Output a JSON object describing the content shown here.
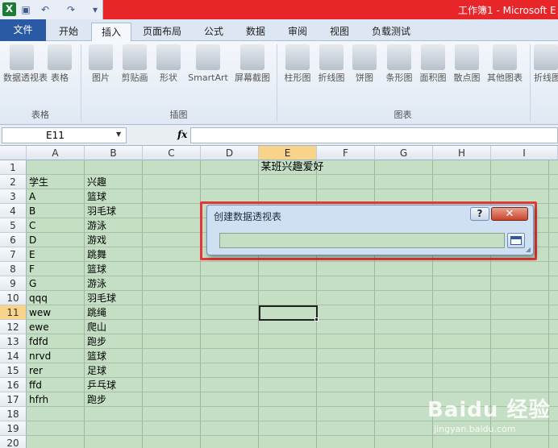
{
  "app": {
    "title": "工作簿1 - Microsoft E"
  },
  "tabs": [
    "文件",
    "开始",
    "插入",
    "页面布局",
    "公式",
    "数据",
    "审阅",
    "视图",
    "负载测试"
  ],
  "ribbon": {
    "tables_group": {
      "label": "表格",
      "buttons": [
        "数据透视表",
        "表格"
      ]
    },
    "illustrations_group": {
      "label": "插图",
      "buttons": [
        "图片",
        "剪贴画",
        "形状",
        "SmartArt",
        "屏幕截图"
      ]
    },
    "charts_group": {
      "label": "图表",
      "buttons": [
        "柱形图",
        "折线图",
        "饼图",
        "条形图",
        "面积图",
        "散点图",
        "其他图表"
      ]
    },
    "extra_button": "折线图"
  },
  "formula_bar": {
    "name_box": "E11",
    "fx": "fx",
    "value": ""
  },
  "columns": [
    "A",
    "B",
    "C",
    "D",
    "E",
    "F",
    "G",
    "H",
    "I"
  ],
  "selected_column": "E",
  "rows": [
    "1",
    "2",
    "3",
    "4",
    "5",
    "6",
    "7",
    "8",
    "9",
    "10",
    "11",
    "12",
    "13",
    "14",
    "15",
    "16",
    "17",
    "18",
    "19",
    "20"
  ],
  "selected_row": "11",
  "sheet": {
    "title": "某班兴趣爱好",
    "header": [
      "学生",
      "兴趣"
    ],
    "data": [
      [
        "A",
        "篮球"
      ],
      [
        "B",
        "羽毛球"
      ],
      [
        "C",
        "游泳"
      ],
      [
        "D",
        "游戏"
      ],
      [
        "E",
        "跳舞"
      ],
      [
        "F",
        "篮球"
      ],
      [
        "G",
        "游泳"
      ],
      [
        "qqq",
        "羽毛球"
      ],
      [
        "wew",
        "跳绳"
      ],
      [
        "ewe",
        "爬山"
      ],
      [
        "fdfd",
        "跑步"
      ],
      [
        "nrvd",
        "篮球"
      ],
      [
        "rer",
        "足球"
      ],
      [
        "ffd",
        "乒乓球"
      ],
      [
        "hfrh",
        "跑步"
      ]
    ]
  },
  "dialog": {
    "title": "创建数据透视表",
    "help": "?",
    "close": "✕",
    "range_value": ""
  },
  "watermark": {
    "logo": "Baidu 经验",
    "url": "jingyan.baidu.com"
  },
  "colors": {
    "sheet_bg": "#c5dfc4",
    "title_bar": "#e8262a",
    "file_tab": "#2a5aa6",
    "highlight_outline": "#e7363a"
  }
}
